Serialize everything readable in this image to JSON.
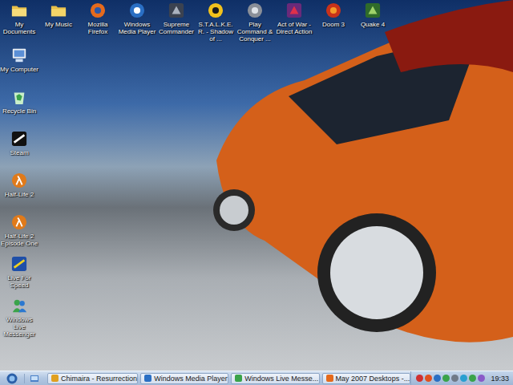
{
  "desktop": {
    "top_row": [
      {
        "label": "My Documents"
      },
      {
        "label": "My Music"
      },
      {
        "label": "Mozilla Firefox"
      },
      {
        "label": "Windows Media Player"
      },
      {
        "label": "Supreme Commander"
      },
      {
        "label": "S.T.A.L.K.E.R. - Shadow of ..."
      },
      {
        "label": "Play Command & Conquer ..."
      },
      {
        "label": "Act of War - Direct Action"
      },
      {
        "label": "Doom 3"
      },
      {
        "label": "Quake 4"
      }
    ],
    "left_column": [
      {
        "label": "My Computer"
      },
      {
        "label": "Recycle Bin"
      },
      {
        "label": "Steam"
      },
      {
        "label": "Half-Life 2"
      },
      {
        "label": "Half-Life 2 Episode One"
      },
      {
        "label": "Live For Speed"
      },
      {
        "label": "Windows Live Messenger"
      }
    ]
  },
  "taskbar": {
    "tasks": [
      {
        "label": "Chimaira - Resurrection",
        "selected": false
      },
      {
        "label": "Windows Media Player",
        "selected": false
      },
      {
        "label": "Windows Live Messe...",
        "selected": false
      },
      {
        "label": "May 2007 Desktops -...",
        "selected": false
      }
    ],
    "clock": "19:33"
  }
}
